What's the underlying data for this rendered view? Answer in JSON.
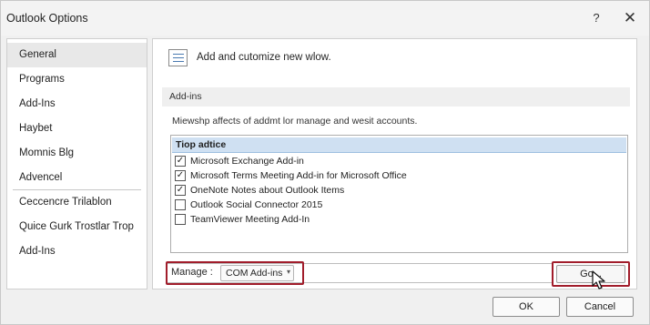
{
  "window": {
    "title": "Outlook Options",
    "help_glyph": "?",
    "close_glyph": "✕"
  },
  "sidebar": {
    "items": [
      {
        "label": "General"
      },
      {
        "label": "Programs"
      },
      {
        "label": "Add-Ins"
      },
      {
        "label": "Haybet"
      },
      {
        "label": "Momnis Blg"
      },
      {
        "label": "Advencel"
      },
      {
        "label": "Ceccencre Trilablon"
      },
      {
        "label": "Quice Gurk Trostlar Trop"
      },
      {
        "label": "Add-Ins"
      }
    ]
  },
  "content": {
    "header_text": "Add and cutomize new wlow.",
    "section_label": "Add-ins",
    "description": "Miewshp affects of addmt lor manage and wesit accounts.",
    "list": {
      "header": "Tiop adtice",
      "items": [
        {
          "label": "Microsoft Exchange Add-in",
          "checked": true,
          "mark": "✓"
        },
        {
          "label": "Microsoft Terms Meeting Add-in for Microsoft Office",
          "checked": true,
          "mark": "✓"
        },
        {
          "label": "OneNote Notes about Outlook Items",
          "checked": true,
          "mark": "✓"
        },
        {
          "label": "Outlook Social Connector 2015",
          "checked": false,
          "mark": ""
        },
        {
          "label": "TeamViewer Meeting Add-In",
          "checked": false,
          "mark": ""
        }
      ]
    },
    "manage": {
      "label": "Manage :",
      "separator": "-",
      "selected": "COM Add-ins",
      "caret": "▾",
      "go_label": "Go..."
    }
  },
  "footer": {
    "ok_label": "OK",
    "cancel_label": "Cancel"
  },
  "colors": {
    "highlight_border": "#a11d2b",
    "list_header_bg": "#cfe0f2",
    "sidebar_active_bg": "#e8e8e8"
  },
  "icons": [
    "question-icon",
    "close-icon",
    "addins-page-icon",
    "checkbox-icon",
    "dropdown-caret-icon",
    "mouse-pointer-icon"
  ]
}
